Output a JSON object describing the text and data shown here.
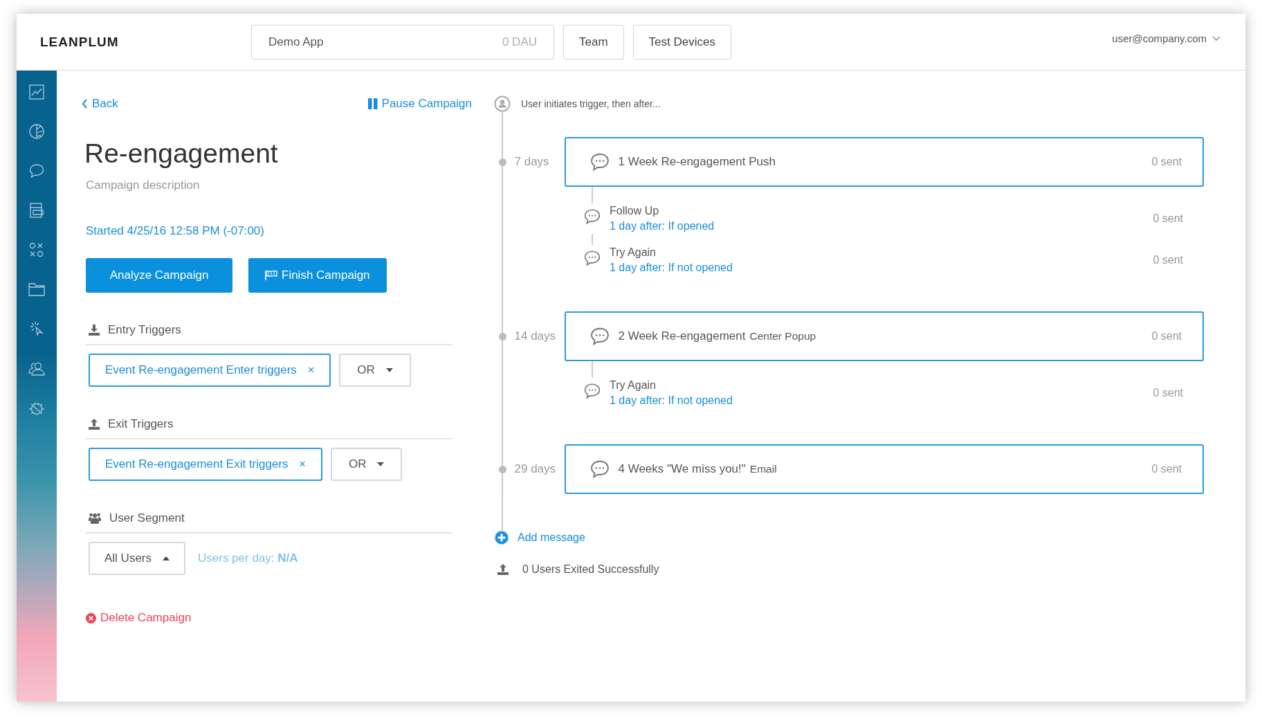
{
  "header": {
    "logo": "LEANPLUM",
    "app_selector": {
      "name": "Demo App",
      "dau": "0 DAU"
    },
    "nav_buttons": [
      "Team",
      "Test Devices"
    ],
    "user": "user@company.com"
  },
  "campaign": {
    "back": "Back",
    "pause": "Pause Campaign",
    "title": "Re-engagement",
    "description": "Campaign description",
    "started": "Started 4/25/16 12:58 PM (-07:00)",
    "buttons": [
      {
        "kind": "analyze",
        "label": "Analyze Campaign"
      },
      {
        "kind": "finish",
        "label": "Finish Campaign"
      }
    ],
    "triggers": [
      {
        "kind": "entry",
        "title": "Entry Triggers",
        "tag": "Event Re-engagement Enter triggers",
        "remove": "×",
        "operator": "OR"
      },
      {
        "kind": "exit",
        "title": "Exit Triggers",
        "tag": "Event Re-engagement Exit triggers",
        "remove": "×",
        "operator": "OR"
      }
    ],
    "segment": {
      "title": "User Segment",
      "dropdown": "All Users",
      "users_per_day": "Users per day: **N/A**"
    },
    "delete": "Delete Campaign"
  },
  "timeline": {
    "intro": "User initiates trigger, then after...",
    "steps": [
      {
        "delay": "7 days",
        "title": "1 Week Re-engagement Push",
        "sent": "0 sent",
        "followups": [
          {
            "title": "Follow Up",
            "condition": "1 day after: If opened",
            "sent": "0 sent"
          },
          {
            "title": "Try Again",
            "condition": "1 day after: If not opened",
            "sent": "0 sent"
          }
        ]
      },
      {
        "delay": "14 days",
        "title": "2 Week Re-engagement",
        "type": "Center Popup",
        "sent": "0 sent",
        "followups": [
          {
            "title": "Try Again",
            "condition": "1 day after: If not opened",
            "sent": "0 sent"
          }
        ]
      },
      {
        "delay": "29 days",
        "title": "4 Weeks \"We miss you!\"",
        "type": "Email",
        "sent": "0 sent"
      }
    ],
    "add": "Add message",
    "exited": "0 Users Exited Successfully"
  }
}
